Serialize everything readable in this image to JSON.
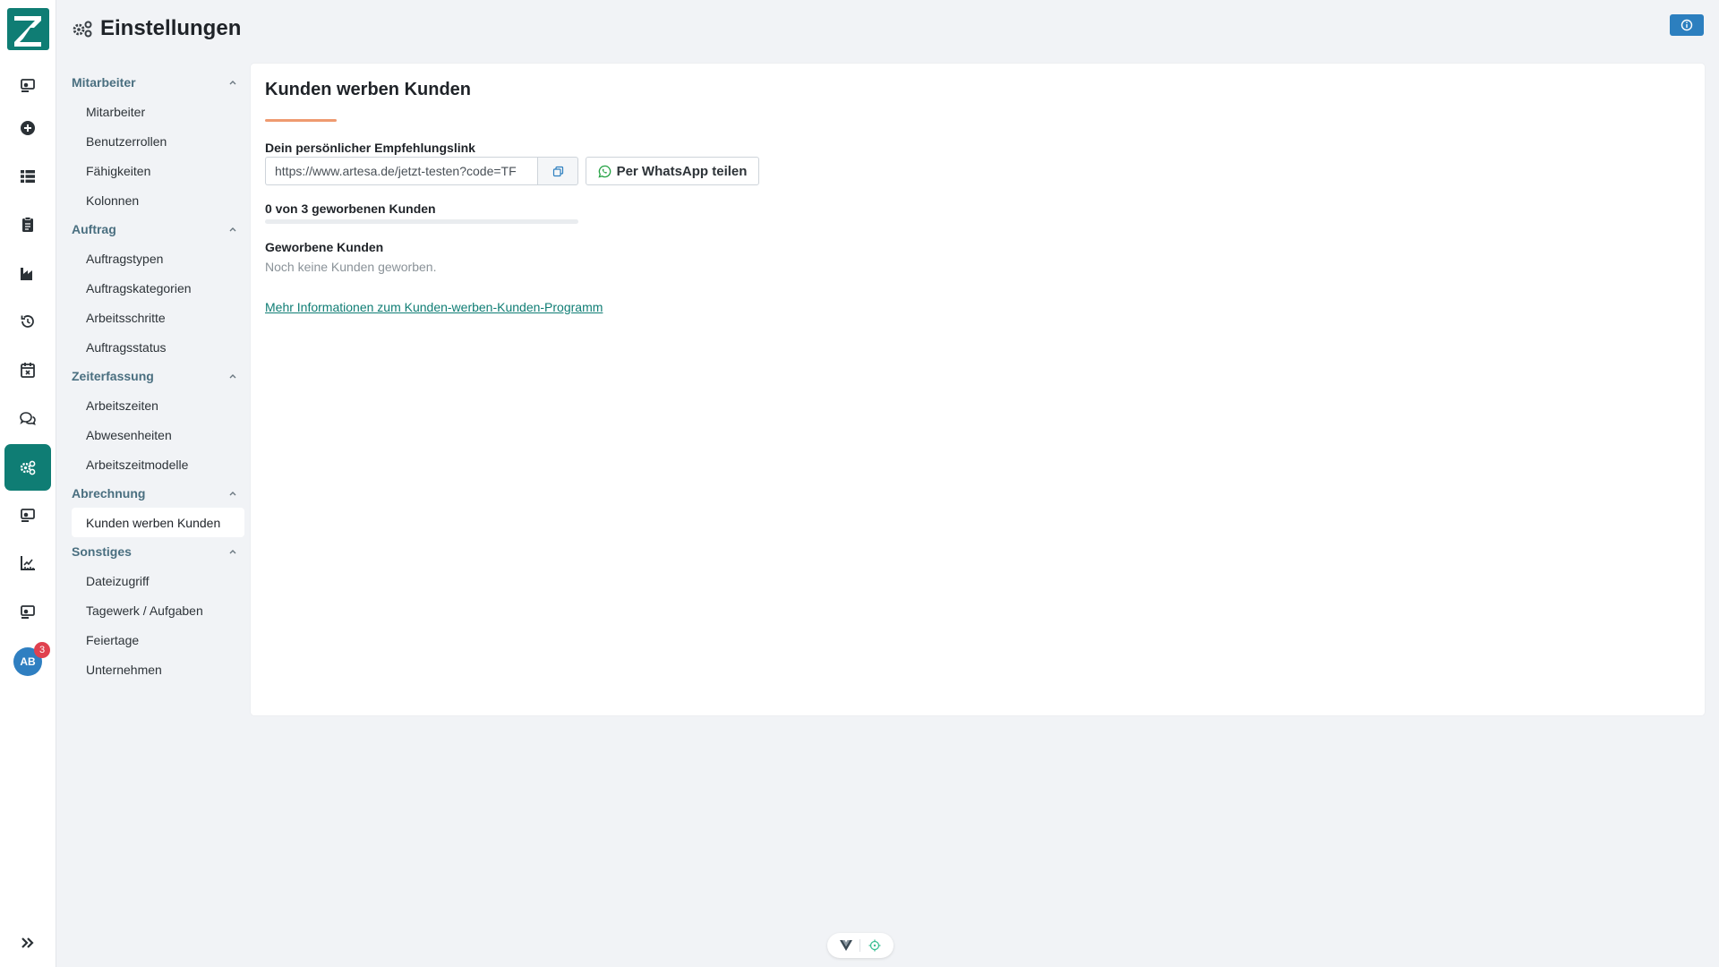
{
  "header": {
    "title": "Einstellungen"
  },
  "rail": {
    "items": [
      {
        "icon": "user-card-icon"
      },
      {
        "icon": "plus-circle-icon"
      },
      {
        "icon": "list-icon"
      },
      {
        "icon": "clipboard-icon"
      },
      {
        "icon": "factory-icon"
      },
      {
        "icon": "clock-rotate-icon"
      },
      {
        "icon": "calendar-x-icon"
      },
      {
        "icon": "chat-icon"
      },
      {
        "icon": "gears-icon",
        "active": true
      },
      {
        "icon": "user-card-icon"
      },
      {
        "icon": "ruler-icon"
      },
      {
        "icon": "user-card-icon"
      }
    ],
    "avatar": {
      "initials": "AB",
      "badge": "3"
    },
    "expand_icon": "double-chevron-right-icon"
  },
  "settings_nav": {
    "groups": [
      {
        "title": "Mitarbeiter",
        "items": [
          "Mitarbeiter",
          "Benutzerrollen",
          "Fähigkeiten",
          "Kolonnen"
        ]
      },
      {
        "title": "Auftrag",
        "items": [
          "Auftragstypen",
          "Auftragskategorien",
          "Arbeitsschritte",
          "Auftragsstatus"
        ]
      },
      {
        "title": "Zeiterfassung",
        "items": [
          "Arbeitszeiten",
          "Abwesenheiten",
          "Arbeitszeitmodelle"
        ]
      },
      {
        "title": "Abrechnung",
        "items": [
          "Kunden werben Kunden"
        ]
      },
      {
        "title": "Sonstiges",
        "items": [
          "Dateizugriff",
          "Tagewerk / Aufgaben",
          "Feiertage",
          "Unternehmen"
        ]
      }
    ],
    "active_item": "Kunden werben Kunden"
  },
  "main": {
    "title": "Kunden werben Kunden",
    "link_label": "Dein persönlicher Empfehlungslink",
    "link_value": "https://www.artesa.de/jetzt-testen?code=TF",
    "whatsapp_label": "Per WhatsApp teilen",
    "progress_text": "0 von 3 geworbenen Kunden",
    "progress_fraction": 0,
    "referred_title": "Geworbene Kunden",
    "referred_empty": "Noch keine Kunden geworben.",
    "more_info_link": "Mehr Informationen zum Kunden-werben-Kunden-Programm"
  },
  "colors": {
    "brand": "#0f7d74",
    "accent_underline": "#ef9a70",
    "info_button": "#2c7fbf",
    "badge": "#e0414f"
  }
}
